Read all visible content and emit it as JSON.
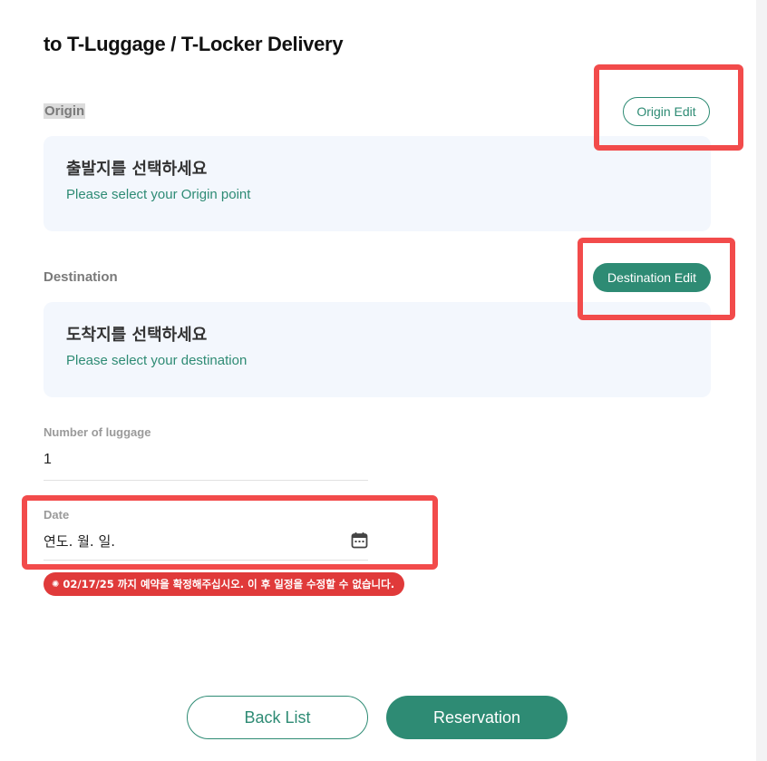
{
  "page": {
    "title": "to T-Luggage / T-Locker Delivery"
  },
  "origin": {
    "label": "Origin",
    "edit_button": "Origin Edit",
    "title_ko": "출발지를 선택하세요",
    "subtitle": "Please select your Origin point"
  },
  "destination": {
    "label": "Destination",
    "edit_button": "Destination Edit",
    "title_ko": "도착지를 선택하세요",
    "subtitle": "Please select your destination"
  },
  "luggage": {
    "label": "Number of luggage",
    "value": "1"
  },
  "date": {
    "label": "Date",
    "placeholder": "연도. 월. 일.",
    "icon": "calendar-icon"
  },
  "warning": {
    "text": "02/17/25 까지 예약을 확정해주십시오. 이 후 일정을 수정할 수 없습니다.",
    "icon": "asterisk-icon"
  },
  "actions": {
    "back_label": "Back List",
    "reserve_label": "Reservation"
  },
  "colors": {
    "accent": "#2e8b74",
    "warning": "#e03a3a",
    "card_background": "#f3f7fd",
    "highlight": "#f24b4b"
  }
}
